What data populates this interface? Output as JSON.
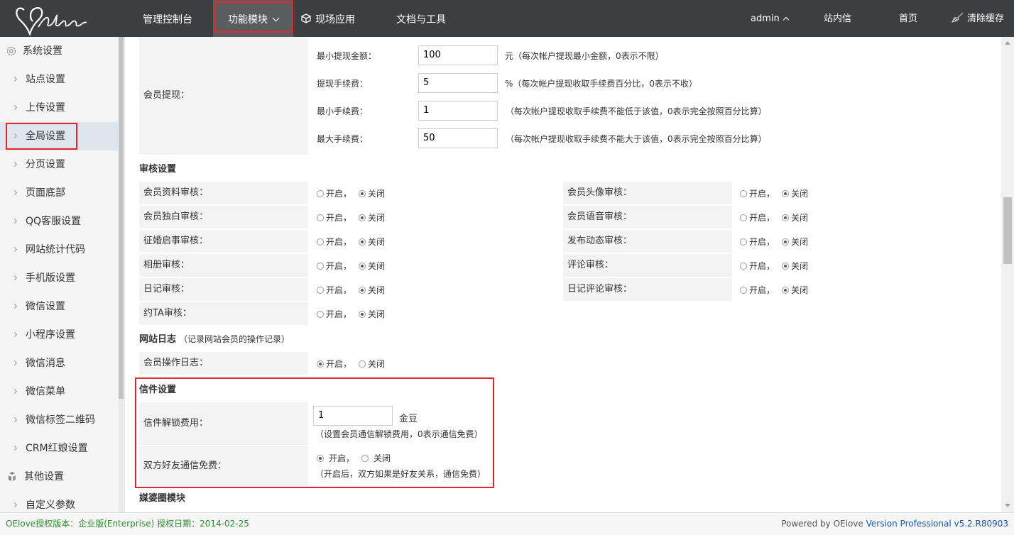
{
  "topnav": {
    "items": [
      "管理控制台",
      "功能模块",
      "现场应用",
      "文档与工具"
    ],
    "user": "admin",
    "links": [
      "站内信",
      "首页",
      "清除缓存"
    ]
  },
  "sidebar": {
    "group1": "系统设置",
    "items": [
      "站点设置",
      "上传设置",
      "全局设置",
      "分页设置",
      "页面底部",
      "QQ客服设置",
      "网站统计代码",
      "手机版设置",
      "微信设置",
      "小程序设置",
      "微信消息",
      "微信菜单",
      "微信标签二维码",
      "CRM红娘设置"
    ],
    "active_item": "全局设置",
    "group2": "其他设置",
    "item_after": "自定义参数"
  },
  "withdraw": {
    "label": "会员提现：",
    "rows": [
      {
        "name": "最小提现金额：",
        "value": "100",
        "note": "元（每次帐户提现最小金额，0表示不限）"
      },
      {
        "name": "提现手续费：",
        "value": "5",
        "note": "%（每次帐户提现收取手续费百分比，0表示不收）"
      },
      {
        "name": "最小手续费：",
        "value": "1",
        "note": "（每次帐户提现收取手续费不能低于该值，0表示完全按照百分比算）"
      },
      {
        "name": "最大手续费：",
        "value": "50",
        "note": "（每次帐户提现收取手续费不能大于该值，0表示完全按照百分比算）"
      }
    ]
  },
  "options": {
    "open": "开启，",
    "close": "关闭"
  },
  "audit": {
    "title": "审核设置",
    "left": [
      {
        "label": "会员资料审核：",
        "value": "close"
      },
      {
        "label": "会员独白审核：",
        "value": "close"
      },
      {
        "label": "征婚启事审核：",
        "value": "close"
      },
      {
        "label": "相册审核：",
        "value": "close"
      },
      {
        "label": "日记审核：",
        "value": "close"
      },
      {
        "label": "约TA审核：",
        "value": "close"
      }
    ],
    "right": [
      {
        "label": "会员头像审核：",
        "value": "close"
      },
      {
        "label": "会员语音审核：",
        "value": "close"
      },
      {
        "label": "发布动态审核：",
        "value": "close"
      },
      {
        "label": "评论审核：",
        "value": "close"
      },
      {
        "label": "日记评论审核：",
        "value": "close"
      }
    ]
  },
  "sitelog": {
    "title": "网站日志",
    "note": "（记录网站会员的操作记录）",
    "label": "会员操作日志：",
    "value": "open"
  },
  "letter": {
    "title": "信件设置",
    "unlock_label": "信件解锁费用：",
    "unlock_value": "1",
    "unlock_unit": "金豆",
    "unlock_note": "（设置会员通信解锁费用，0表示通信免费）",
    "free_label": "双方好友通信免费：",
    "free_value": "open",
    "free_note": "（开启后，双方如果是好友关系，通信免费）"
  },
  "next_section": "媒婆圈模块",
  "footer": {
    "license": "OElove授权版本：企业版(Enterprise) 授权日期：2014-02-25",
    "powered": "Powered by OElove",
    "version": "Version Professional v5.2.R80903"
  },
  "colors": {
    "topbar": "#3c3f41",
    "highlight": "#e3262c",
    "link": "#1b56b5",
    "license": "#2e8b2e"
  }
}
